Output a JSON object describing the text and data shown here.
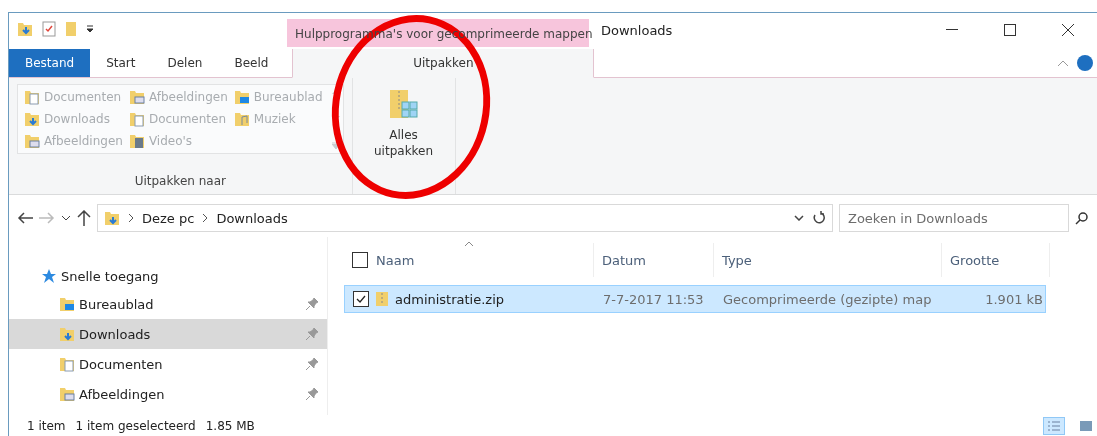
{
  "window": {
    "title": "Downloads",
    "contextual_tab_group": "Hulpprogramma's voor gecomprimeerde mappen"
  },
  "ribbon_tabs": [
    {
      "label": "Bestand",
      "kind": "file",
      "selected": false
    },
    {
      "label": "Start",
      "kind": "tab",
      "selected": false
    },
    {
      "label": "Delen",
      "kind": "tab",
      "selected": false
    },
    {
      "label": "Beeld",
      "kind": "tab",
      "selected": false
    },
    {
      "label": "Uitpakken",
      "kind": "contextual",
      "selected": true
    }
  ],
  "extract_to": {
    "label": "Uitpakken naar",
    "items": [
      {
        "label": "Documenten",
        "kind": "doc",
        "disabled": true
      },
      {
        "label": "Afbeeldingen",
        "kind": "pic",
        "disabled": true
      },
      {
        "label": "Bureaublad",
        "kind": "desk",
        "disabled": true
      },
      {
        "label": "Downloads",
        "kind": "down",
        "disabled": true
      },
      {
        "label": "Documenten",
        "kind": "doc",
        "disabled": true
      },
      {
        "label": "Muziek",
        "kind": "music",
        "disabled": true
      },
      {
        "label": "Afbeeldingen",
        "kind": "pic",
        "disabled": true
      },
      {
        "label": "Video's",
        "kind": "video",
        "disabled": true
      }
    ]
  },
  "extract_all_button": {
    "label": "Alles uitpakken"
  },
  "address_bar": {
    "breadcrumbs": [
      "Deze pc",
      "Downloads"
    ]
  },
  "search": {
    "placeholder": "Zoeken in Downloads"
  },
  "navigation": {
    "header": "Snelle toegang",
    "items": [
      {
        "label": "Bureaublad",
        "kind": "desk",
        "selected": false,
        "pinned": true
      },
      {
        "label": "Downloads",
        "kind": "down",
        "selected": true,
        "pinned": true
      },
      {
        "label": "Documenten",
        "kind": "doc",
        "selected": false,
        "pinned": true
      },
      {
        "label": "Afbeeldingen",
        "kind": "pic",
        "selected": false,
        "pinned": true
      }
    ]
  },
  "table": {
    "select_all_checked": false,
    "columns": [
      {
        "label": "Naam",
        "sorted": true
      },
      {
        "label": "Datum",
        "sorted": false
      },
      {
        "label": "Type",
        "sorted": false
      },
      {
        "label": "Grootte",
        "sorted": false
      }
    ],
    "rows": [
      {
        "name": "administratie.zip",
        "date": "7-7-2017 11:53",
        "type": "Gecomprimeerde (gezipte) map",
        "size": "1.901 kB",
        "selected": true,
        "checked": true
      }
    ]
  },
  "status_bar": {
    "count": "1 item",
    "selection": "1 item geselecteerd",
    "size": "1.85 MB"
  },
  "view_buttons": [
    {
      "kind": "details",
      "selected": true
    },
    {
      "kind": "tiles",
      "selected": false
    }
  ]
}
